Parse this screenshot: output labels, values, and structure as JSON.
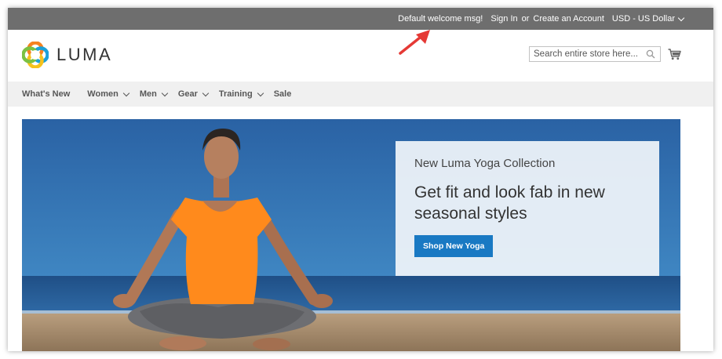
{
  "top_bar": {
    "welcome": "Default welcome msg!",
    "sign_in": "Sign In",
    "or": "or",
    "create_account": "Create an Account",
    "currency": "USD - US Dollar"
  },
  "header": {
    "logo_text": "LUMA",
    "search_placeholder": "Search entire store here...",
    "search_icon": "search-icon",
    "cart_icon": "cart-icon"
  },
  "nav": {
    "items": [
      {
        "label": "What's New",
        "has_dropdown": false
      },
      {
        "label": "Women",
        "has_dropdown": true
      },
      {
        "label": "Men",
        "has_dropdown": true
      },
      {
        "label": "Gear",
        "has_dropdown": true
      },
      {
        "label": "Training",
        "has_dropdown": true
      },
      {
        "label": "Sale",
        "has_dropdown": false
      }
    ]
  },
  "hero": {
    "subtitle": "New Luma Yoga Collection",
    "title": "Get fit and look fab in new seasonal styles",
    "button_label": "Shop New Yoga"
  },
  "colors": {
    "top_bar_bg": "#6e6e6e",
    "nav_bg": "#f0f0f0",
    "button_blue": "#1979c3",
    "annotation_arrow": "#e53935"
  }
}
